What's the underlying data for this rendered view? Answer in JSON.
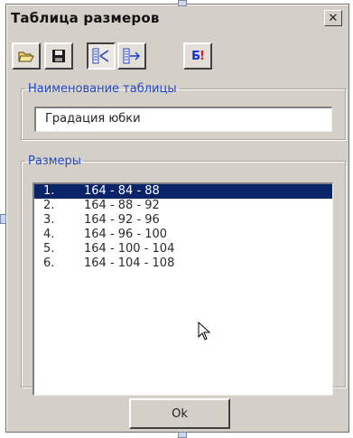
{
  "window": {
    "title": "Таблица размеров",
    "close_label": "✕"
  },
  "toolbar": {
    "buttons": [
      {
        "icon": "open-folder-icon"
      },
      {
        "icon": "save-disk-icon"
      },
      {
        "icon": "split-sizes-icon",
        "pressed": true
      },
      {
        "icon": "export-arrow-icon"
      },
      {
        "icon": "b-exclaim-icon",
        "label": "Б!"
      }
    ]
  },
  "name_group": {
    "legend": "Наименование таблицы",
    "value": "Градация юбки"
  },
  "sizes_group": {
    "legend": "Размеры",
    "items": [
      {
        "num": "1.",
        "text": "164 - 84 - 88"
      },
      {
        "num": "2.",
        "text": "164 - 88 - 92"
      },
      {
        "num": "3.",
        "text": "164 - 92 - 96"
      },
      {
        "num": "4.",
        "text": "164 - 96 - 100"
      },
      {
        "num": "5.",
        "text": "164 - 100 - 104"
      },
      {
        "num": "6.",
        "text": "164 - 104 - 108"
      }
    ],
    "selected_index": 0
  },
  "ok_button": {
    "label": "Ok"
  },
  "colors": {
    "selection": "#0a246a",
    "legend_text": "#1f45c8",
    "dialog_bg": "#d4d0c8"
  }
}
